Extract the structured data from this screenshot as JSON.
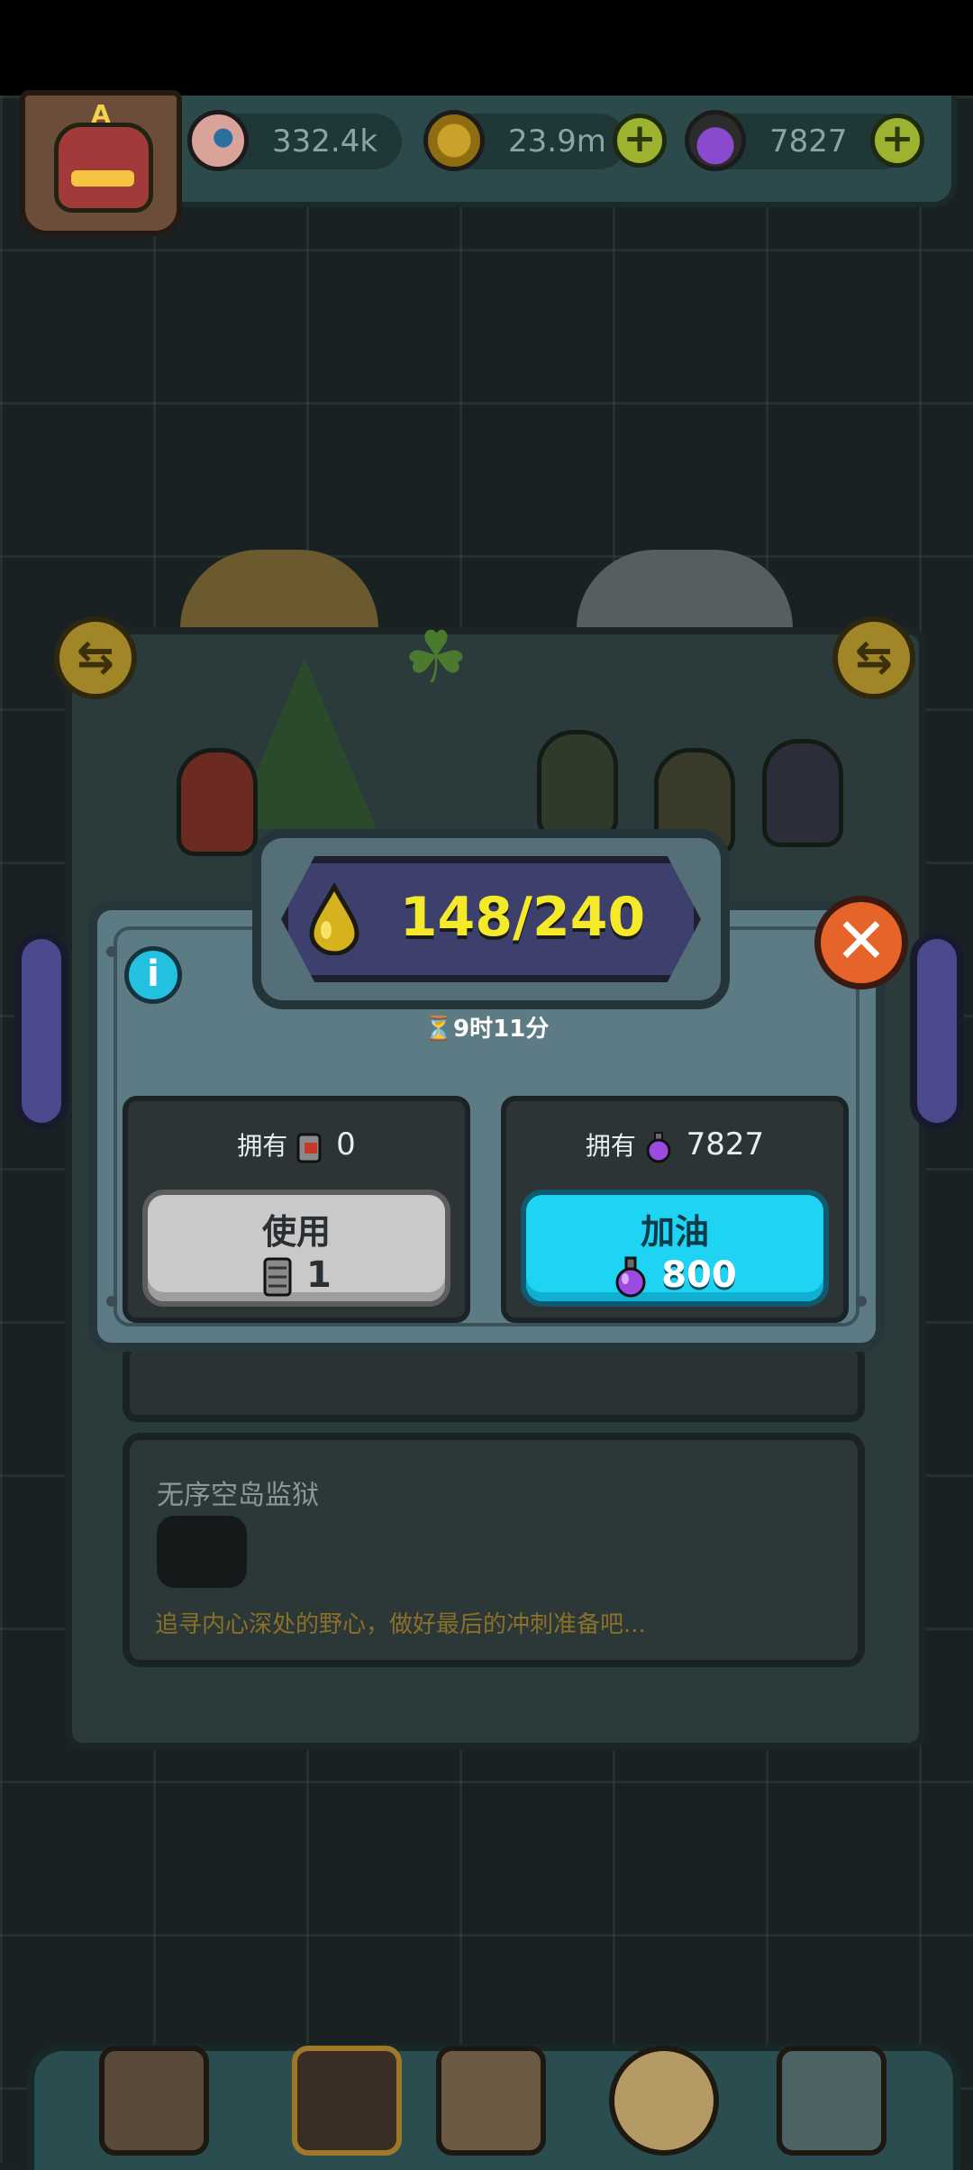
{
  "top_bar": {
    "badge_letter": "A",
    "eyes": "332.4k",
    "coins": "23.9m",
    "potions": "7827",
    "add_label": "+"
  },
  "popup": {
    "fuel": "148/240",
    "timer": "9时11分",
    "info_label": "i",
    "close_label": "✕",
    "left_card": {
      "owned_label": "拥有",
      "owned_count": "0",
      "button_label": "使用",
      "button_cost": "1"
    },
    "right_card": {
      "owned_label": "拥有",
      "owned_count": "7827",
      "button_label": "加油",
      "button_cost": "800"
    }
  },
  "mission": {
    "title": "无序空岛监狱",
    "description": "追寻内心深处的野心，做好最后的冲刺准备吧..."
  },
  "swap_label": "⇆",
  "colors": {
    "fuel_text": "#f5ea2a",
    "refuel_button": "#1fd3f3",
    "use_button": "#c9c9c9",
    "close_button": "#e6642a",
    "info_button": "#23c0e0"
  },
  "icons": [
    "eyeball-icon",
    "coin-icon",
    "potion-icon",
    "oil-drop-icon",
    "hourglass-icon",
    "fuel-can-icon",
    "close-icon",
    "info-icon",
    "swap-icon"
  ]
}
